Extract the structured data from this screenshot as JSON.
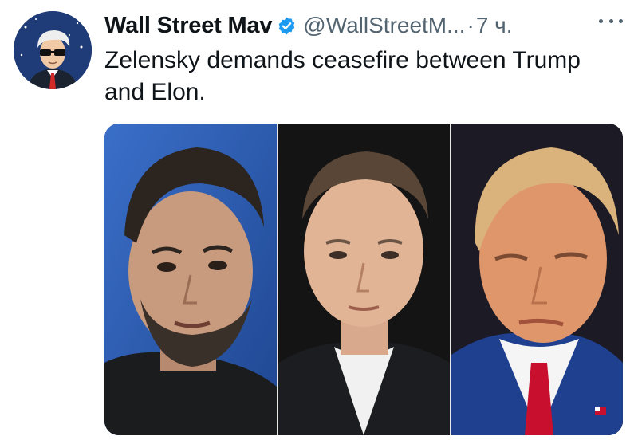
{
  "tweet": {
    "author_name": "Wall Street Mav",
    "verified": true,
    "handle": "@WallStreetM...",
    "separator": "·",
    "time": "7 ч.",
    "text": "Zelensky demands ceasefire between Trump and Elon."
  },
  "colors": {
    "verified_blue": "#1d9bf0",
    "secondary_text": "#536471",
    "primary_text": "#0f1419"
  },
  "icons": {
    "verified": "verified-badge-icon",
    "more": "more-options-icon"
  },
  "media": {
    "panels": [
      "zelensky-photo",
      "elon-photo",
      "trump-photo"
    ]
  }
}
